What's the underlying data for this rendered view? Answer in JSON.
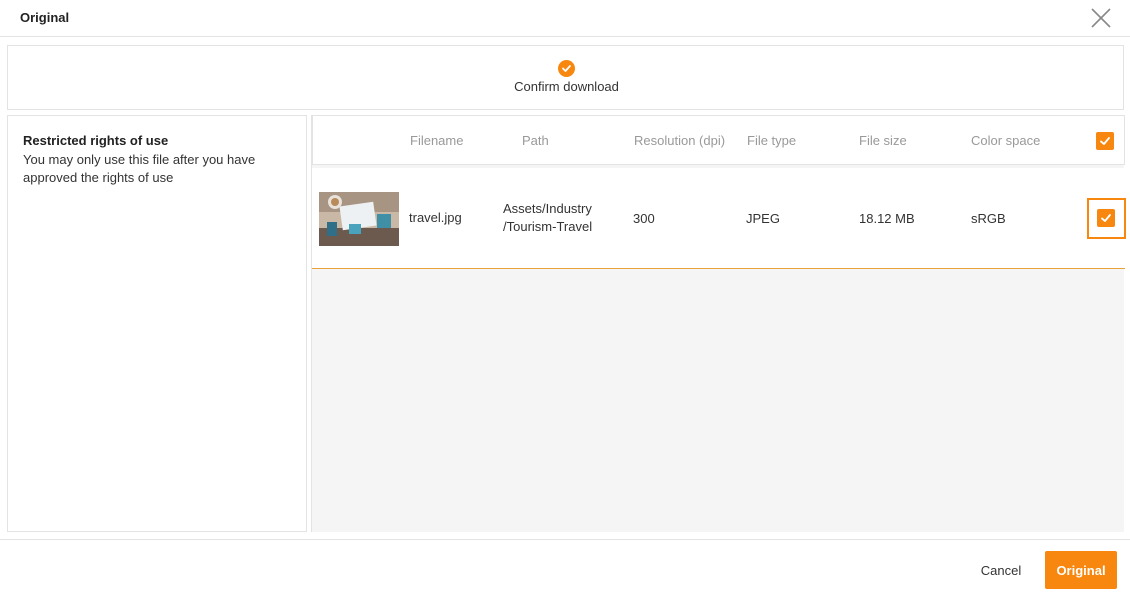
{
  "dialog": {
    "title": "Original",
    "close_icon": "close-icon"
  },
  "steps": {
    "current": {
      "icon": "check-circle-icon",
      "label": "Confirm download"
    }
  },
  "rights": {
    "title": "Restricted rights of use",
    "text": "You may only use this file after you have approved the rights of use"
  },
  "table": {
    "columns": [
      "Filename",
      "Path",
      "Resolution (dpi)",
      "File type",
      "File size",
      "Color space"
    ],
    "select_all_checked": true,
    "rows": [
      {
        "filename": "travel.jpg",
        "path_line1": "Assets/Industry",
        "path_line2": "/Tourism-Travel",
        "resolution": "300",
        "file_type": "JPEG",
        "file_size": "18.12 MB",
        "color_space": "sRGB",
        "checked": true
      }
    ]
  },
  "footer": {
    "cancel_label": "Cancel",
    "primary_label": "Original"
  },
  "colors": {
    "accent": "#f7870f",
    "border": "#e3e3e3",
    "header_text": "#999999"
  }
}
